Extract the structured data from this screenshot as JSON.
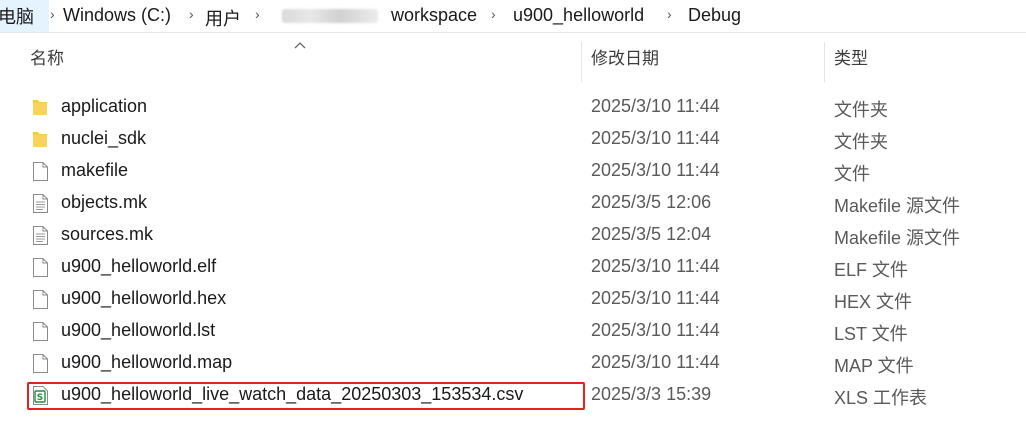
{
  "breadcrumb": {
    "items": [
      "电脑",
      "Windows (C:)",
      "用户",
      "workspace",
      "u900_helloworld",
      "Debug"
    ],
    "separator": "›"
  },
  "columns": {
    "name": "名称",
    "date": "修改日期",
    "type": "类型"
  },
  "files": [
    {
      "name": "application",
      "date": "2025/3/10 11:44",
      "type": "文件夹",
      "icon": "folder-icon"
    },
    {
      "name": "nuclei_sdk",
      "date": "2025/3/10 11:44",
      "type": "文件夹",
      "icon": "folder-icon"
    },
    {
      "name": "makefile",
      "date": "2025/3/10 11:44",
      "type": "文件",
      "icon": "file-icon"
    },
    {
      "name": "objects.mk",
      "date": "2025/3/5 12:06",
      "type": "Makefile 源文件",
      "icon": "text-file-icon"
    },
    {
      "name": "sources.mk",
      "date": "2025/3/5 12:04",
      "type": "Makefile 源文件",
      "icon": "text-file-icon"
    },
    {
      "name": "u900_helloworld.elf",
      "date": "2025/3/10 11:44",
      "type": "ELF 文件",
      "icon": "file-icon"
    },
    {
      "name": "u900_helloworld.hex",
      "date": "2025/3/10 11:44",
      "type": "HEX 文件",
      "icon": "file-icon"
    },
    {
      "name": "u900_helloworld.lst",
      "date": "2025/3/10 11:44",
      "type": "LST 文件",
      "icon": "file-icon"
    },
    {
      "name": "u900_helloworld.map",
      "date": "2025/3/10 11:44",
      "type": "MAP 文件",
      "icon": "file-icon"
    },
    {
      "name": "u900_helloworld_live_watch_data_20250303_153534.csv",
      "date": "2025/3/3 15:39",
      "type": "XLS 工作表",
      "icon": "spreadsheet-icon"
    }
  ],
  "colors": {
    "highlight": "#e8201c",
    "folder": "#f7c948",
    "spreadsheet": "#1e8e3e",
    "crumb_hover": "#e5f3ff"
  }
}
